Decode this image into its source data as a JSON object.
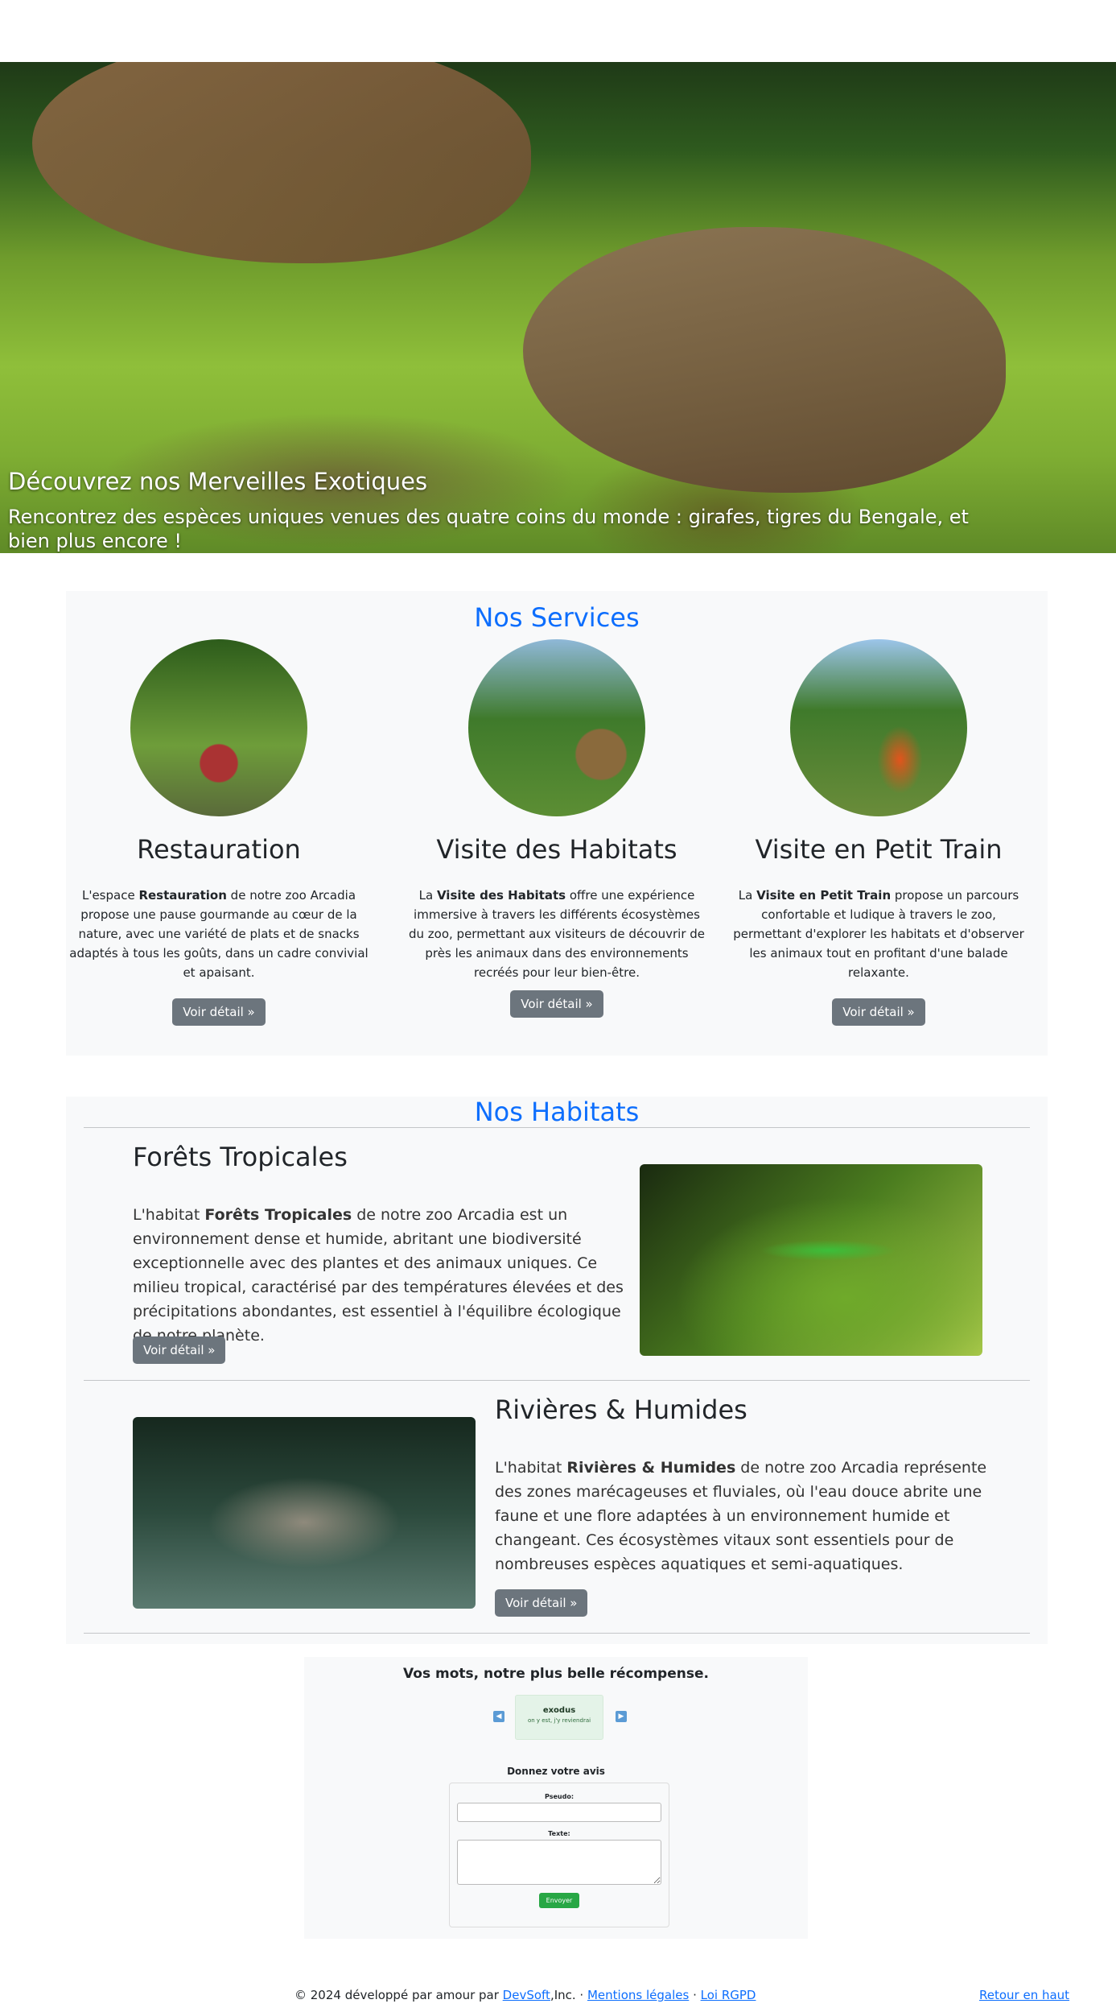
{
  "hero": {
    "title": "Découvrez nos Merveilles Exotiques",
    "subtitle": "Rencontrez des espèces uniques venues des quatre coins du monde : girafes, tigres du Bengale, et bien plus encore !"
  },
  "services": {
    "title": "Nos Services",
    "items": [
      {
        "name": "Restauration",
        "desc_pre": "L'espace ",
        "desc_bold": "Restauration",
        "desc_post": " de notre zoo Arcadia propose une pause gourmande au cœur de la nature, avec une variété de plats et de snacks adaptés à tous les goûts, dans un cadre convivial et apaisant.",
        "button": "Voir détail »"
      },
      {
        "name": "Visite des Habitats",
        "desc_pre": "La ",
        "desc_bold": "Visite des Habitats",
        "desc_post": " offre une expérience immersive à travers les différents écosystèmes du zoo, permettant aux visiteurs de découvrir de près les animaux dans des environnements recréés pour leur bien-être.",
        "button": "Voir détail »"
      },
      {
        "name": "Visite en Petit Train",
        "desc_pre": "La ",
        "desc_bold": "Visite en Petit Train",
        "desc_post": " propose un parcours confortable et ludique à travers le zoo, permettant d'explorer les habitats et d'observer les animaux tout en profitant d'une balade relaxante.",
        "button": "Voir détail »"
      }
    ]
  },
  "habitats": {
    "title": "Nos Habitats",
    "items": [
      {
        "name": "Forêts Tropicales",
        "desc_pre": "L'habitat ",
        "desc_bold": "Forêts Tropicales",
        "desc_post": " de notre zoo Arcadia est un environnement dense et humide, abritant une biodiversité exceptionnelle avec des plantes et des animaux uniques. Ce milieu tropical, caractérisé par des températures élevées et des précipitations abondantes, est essentiel à l'équilibre écologique de notre planète.",
        "button": "Voir détail »"
      },
      {
        "name": "Rivières & Humides",
        "desc_pre": "L'habitat ",
        "desc_bold": "Rivières & Humides",
        "desc_post": " de notre zoo Arcadia représente des zones marécageuses et fluviales, où l'eau douce abrite une faune et une flore adaptées à un environnement humide et changeant. Ces écosystèmes vitaux sont essentiels pour de nombreuses espèces aquatiques et semi-aquatiques.",
        "button": "Voir détail »"
      }
    ]
  },
  "reviews": {
    "title": "Vos mots, notre plus belle récompense.",
    "card": {
      "pseudo": "exodus",
      "text": "on y est, j'y reviendrai"
    },
    "form_title": "Donnez votre avis",
    "pseudo_label": "Pseudo:",
    "text_label": "Texte:",
    "submit": "Envoyer"
  },
  "footer": {
    "copyright_pre": "© 2024 développé par amour par ",
    "company_link": "DevSoft",
    "company_suffix": ",Inc. · ",
    "legal_link": "Mentions légales",
    "separator": " · ",
    "rgpd_link": "Loi RGPD",
    "back_top": "Retour en haut"
  }
}
